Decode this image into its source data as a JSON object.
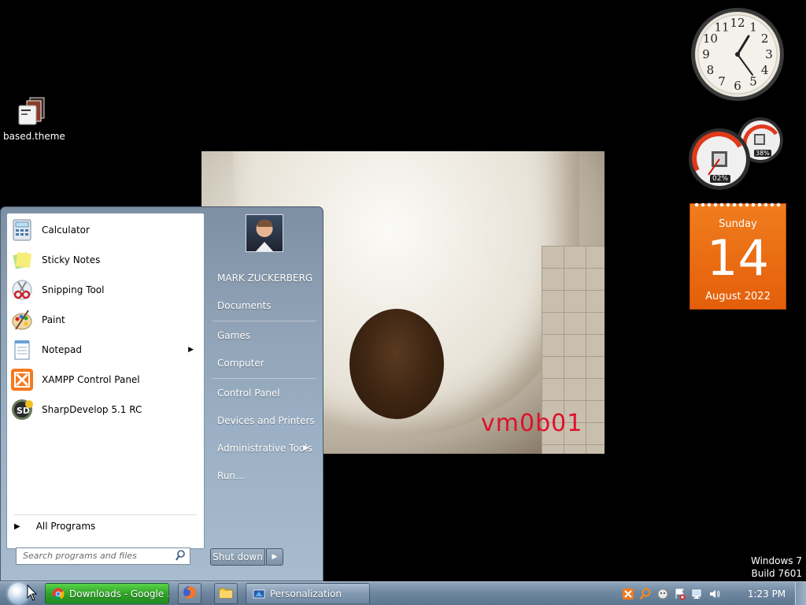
{
  "desktop": {
    "icons": [
      {
        "label": "based.theme"
      }
    ],
    "wallpaper_watermark": "vm0b01",
    "windows_version": "Windows 7",
    "windows_build": "Build 7601"
  },
  "gadgets": {
    "clock": {
      "time": "1:23",
      "numerals": [
        "12",
        "1",
        "2",
        "3",
        "4",
        "5",
        "6",
        "7",
        "8",
        "9",
        "10",
        "11"
      ]
    },
    "cpu_meter": {
      "cpu_percent": "02%",
      "memory_percent": "38%"
    },
    "calendar": {
      "weekday": "Sunday",
      "day": "14",
      "month_year": "August 2022"
    }
  },
  "start_menu": {
    "pinned_programs": [
      {
        "label": "Calculator",
        "icon": "calculator-icon"
      },
      {
        "label": "Sticky Notes",
        "icon": "sticky-notes-icon"
      },
      {
        "label": "Snipping Tool",
        "icon": "scissors-icon"
      },
      {
        "label": "Paint",
        "icon": "palette-icon"
      },
      {
        "label": "Notepad",
        "icon": "notepad-icon",
        "has_submenu": true
      },
      {
        "label": "XAMPP Control Panel",
        "icon": "xampp-icon"
      },
      {
        "label": "SharpDevelop 5.1 RC",
        "icon": "sharpdevelop-icon"
      }
    ],
    "all_programs": "All Programs",
    "search_placeholder": "Search programs and files",
    "user_name": "MARK ZUCKERBERG",
    "right_items": [
      {
        "label": "Documents"
      },
      {
        "label": "Games"
      },
      {
        "label": "Computer"
      },
      {
        "label": "Control Panel"
      },
      {
        "label": "Devices and Printers"
      },
      {
        "label": "Administrative Tools",
        "has_submenu": true
      },
      {
        "label": "Run..."
      }
    ],
    "shutdown_label": "Shut down"
  },
  "taskbar": {
    "buttons": [
      {
        "label": "Downloads - Google ...",
        "icon": "chrome-icon",
        "active": true
      },
      {
        "label": "",
        "icon": "firefox-icon"
      },
      {
        "label": "",
        "icon": "folder-icon"
      },
      {
        "label": "Personalization",
        "icon": "personalization-icon"
      }
    ],
    "tray_icons": [
      "xampp-icon",
      "search-tray-icon",
      "messenger-icon",
      "action-center-icon",
      "network-icon",
      "volume-icon"
    ],
    "time": "1:23 PM"
  },
  "colors": {
    "taskbar": "#6f879f",
    "calendar": "#e8650f",
    "chrome_button": "#2fa42a",
    "watermark": "#e0102a"
  }
}
